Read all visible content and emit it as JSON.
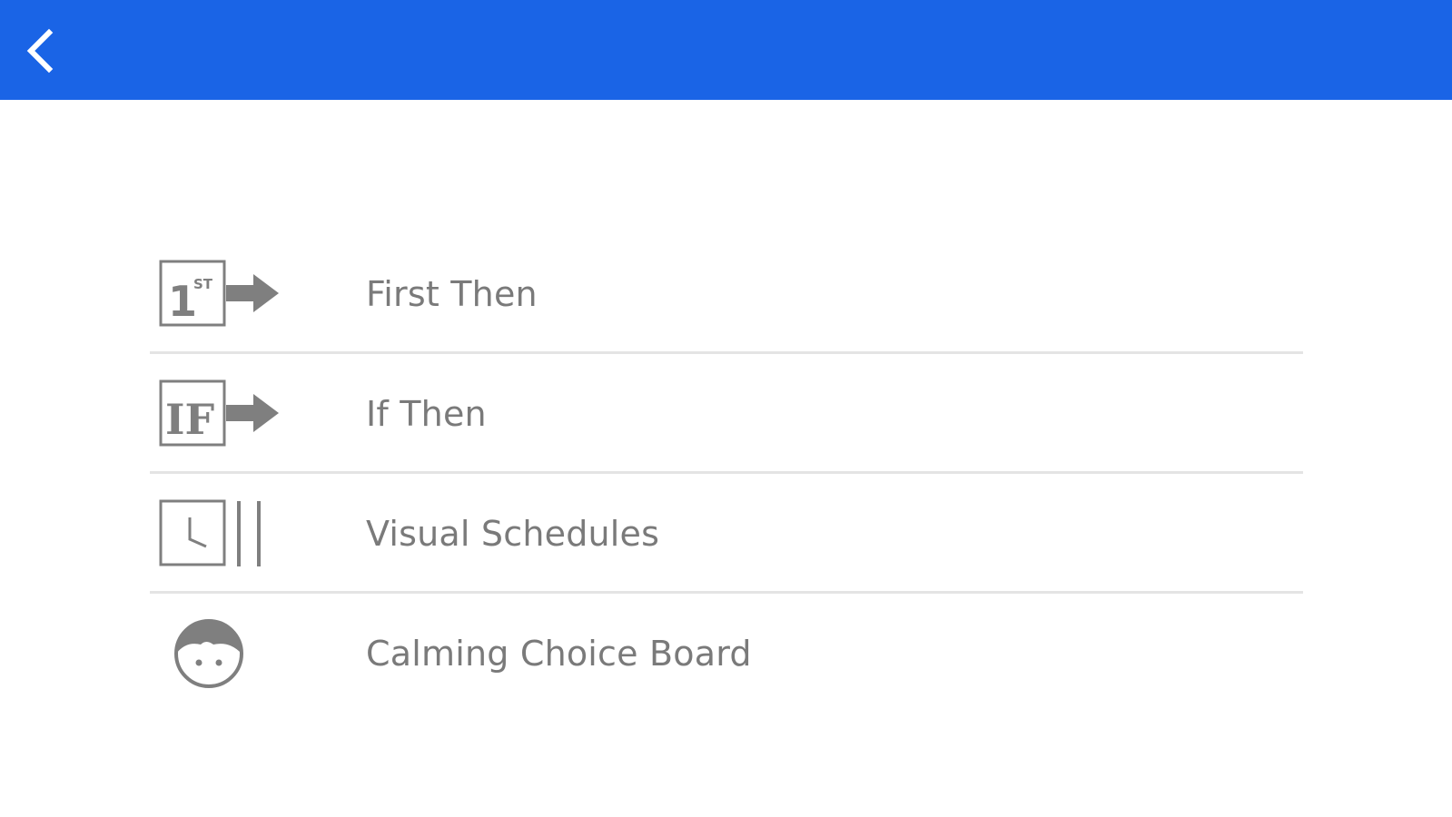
{
  "header": {
    "back_icon": "chevron-left-icon",
    "background_color": "#1a64e6"
  },
  "menu": {
    "label_color": "#7a7a7a",
    "icon_color": "#7f7f7f",
    "divider_color": "#e4e4e4",
    "items": [
      {
        "id": "first-then",
        "label": "First Then",
        "icon": "first-then-icon",
        "icon_text_main": "1",
        "icon_text_sup": "ST"
      },
      {
        "id": "if-then",
        "label": "If Then",
        "icon": "if-then-icon",
        "icon_text_main": "IF"
      },
      {
        "id": "visual-schedules",
        "label": "Visual Schedules",
        "icon": "clock-schedule-icon"
      },
      {
        "id": "calming-choice-board",
        "label": "Calming Choice Board",
        "icon": "face-icon"
      }
    ]
  }
}
